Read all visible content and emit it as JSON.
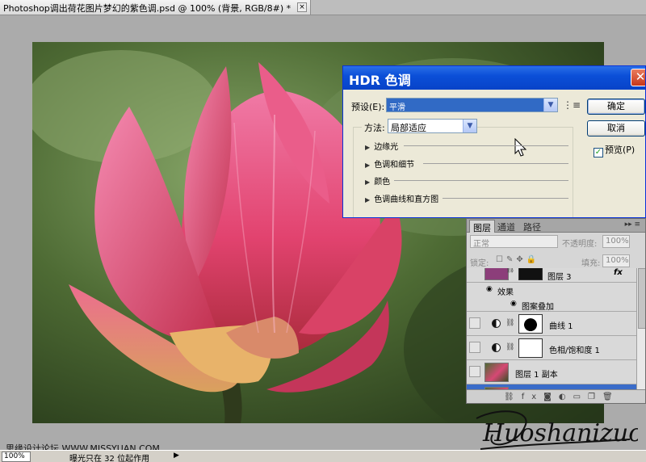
{
  "document": {
    "tab_title": "Photoshop调出荷花图片梦幻的紫色调.psd @ 100% (背景, RGB/8#) *",
    "close_glyph": "×"
  },
  "hdr_dialog": {
    "title": "HDR 色调",
    "close_glyph": "✕",
    "preset_label": "预设(E):",
    "preset_value": "平滑",
    "ok_label": "确定",
    "cancel_label": "取消",
    "preview_label": "预览(P)",
    "preview_checked": true,
    "method_label": "方法:",
    "method_value": "局部适应",
    "sections": [
      "边缘光",
      "色调和细节",
      "颜色",
      "色调曲线和直方图"
    ]
  },
  "layers_panel": {
    "tabs": [
      "图层",
      "通道",
      "路径"
    ],
    "panel_menu": "▸▸ ≡",
    "blend_mode": "正常",
    "opacity_label": "不透明度:",
    "opacity_value": "100%",
    "lock_label": "锁定:",
    "fill_label": "填充:",
    "fill_value": "100%",
    "layers": [
      {
        "name": "图层 3",
        "kind": "image-with-mask",
        "fx": "fx"
      },
      {
        "name": "效果",
        "kind": "effects-group"
      },
      {
        "name": "图案叠加",
        "kind": "effect"
      },
      {
        "name": "曲线 1",
        "kind": "adjustment"
      },
      {
        "name": "色相/饱和度 1",
        "kind": "adjustment"
      },
      {
        "name": "图层 1 副本",
        "kind": "image"
      },
      {
        "name": "背景",
        "kind": "image",
        "selected": true,
        "visible": true
      }
    ],
    "footer_icons": [
      "link-icon",
      "fx-icon",
      "mask-icon",
      "adjustment-icon",
      "folder-icon",
      "new-layer-icon",
      "trash-icon"
    ]
  },
  "status_bar": {
    "zoom": "100%",
    "message": "曝光只在 32 位起作用",
    "arrow": "▶"
  },
  "watermark": {
    "site_text": "思缘设计论坛  WWW.MISSYUAN.COM",
    "signature": "Huoshanizuo"
  }
}
